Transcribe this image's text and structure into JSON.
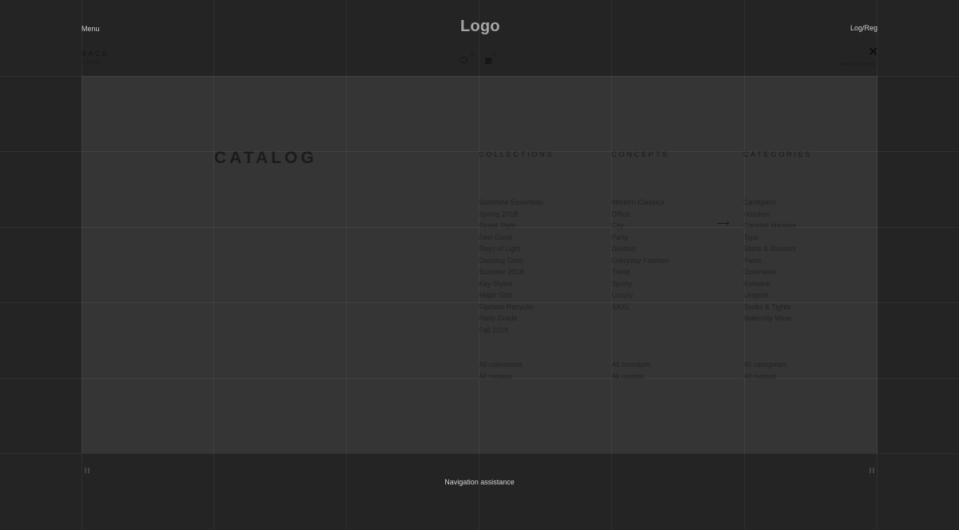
{
  "header": {
    "menu_label": "Menu",
    "logo_text": "Logo",
    "login_label": "Log/Reg"
  },
  "subheader": {
    "back_label": "BACK",
    "back_sub": "к меню",
    "wishlist_count": "0",
    "cart_count": "0",
    "close_sub": "закрыть меню"
  },
  "catalog": {
    "title": "CATALOG",
    "columns": [
      {
        "heading": "COLLECTIONS",
        "items": [
          "Sunshine Essentials",
          "Spring 2018",
          "Street Style",
          "Feel Good",
          "Rays of Light",
          "Dancing Dites",
          "Summer 2018",
          "Key Styles",
          "Major Glitz",
          "Fashion Recycler",
          "Party Grade",
          "Fall 2018"
        ],
        "bottom": [
          "All collections",
          "All models"
        ]
      },
      {
        "heading": "CONCEPTS",
        "items": [
          "Modern Classics",
          "Office",
          "City",
          "Party",
          "Divided",
          "Everyday Fashion",
          "Trend",
          "Sporty",
          "Luxury",
          "XXXL"
        ],
        "bottom": [
          "All concepts",
          "All models"
        ]
      },
      {
        "heading": "CATEGORIES",
        "items": [
          "Cardigans",
          "Hoodies",
          "Cocktail dresses",
          "Tops",
          "Shirts & Blouses",
          "Pants",
          "Outerwear",
          "Knitwear",
          "Lingerie",
          "Socks & Tights",
          "Maternity Wear"
        ],
        "bottom": [
          "All categories",
          "All models"
        ]
      }
    ]
  },
  "footer": {
    "nav_assistance": "Navigation assistance"
  },
  "icons": {
    "heart": "heart-icon",
    "cart": "cart-icon",
    "close": "close-icon",
    "arrow": "arrow-right-icon",
    "pause": "pause-icon"
  },
  "colors": {
    "background": "#242424",
    "panel": "#353535",
    "logo": "#a6a6a6"
  }
}
